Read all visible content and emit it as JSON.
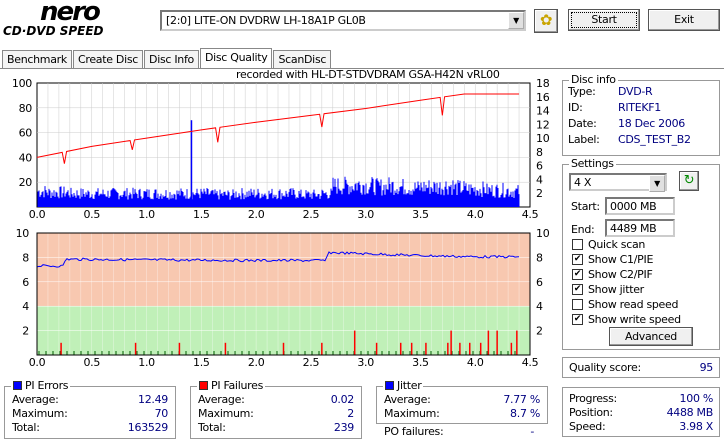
{
  "header": {
    "logo_top": "nero",
    "logo_bottom": "CD·DVD SPEED",
    "drive": "[2:0]  LITE-ON DVDRW LH-18A1P GL0B",
    "start": "Start",
    "exit": "Exit"
  },
  "tabs": [
    "Benchmark",
    "Create Disc",
    "Disc Info",
    "Disc Quality",
    "ScanDisc"
  ],
  "active_tab": "Disc Quality",
  "recorded_with": "recorded with HL-DT-STDVDRAM GSA-H42N  vRL00",
  "disc_info": {
    "title": "Disc info",
    "rows": [
      {
        "label": "Type:",
        "value": "DVD-R"
      },
      {
        "label": "ID:",
        "value": "RITEKF1"
      },
      {
        "label": "Date:",
        "value": "18 Dec 2006"
      },
      {
        "label": "Label:",
        "value": "CDS_TEST_B2"
      }
    ]
  },
  "settings": {
    "title": "Settings",
    "speed": "4 X",
    "start_label": "Start:",
    "start_value": "0000 MB",
    "end_label": "End:",
    "end_value": "4489 MB",
    "checks": [
      {
        "label": "Quick scan",
        "checked": false
      },
      {
        "label": "Show C1/PIE",
        "checked": true
      },
      {
        "label": "Show C2/PIF",
        "checked": true
      },
      {
        "label": "Show jitter",
        "checked": true
      },
      {
        "label": "Show read speed",
        "checked": false
      },
      {
        "label": "Show write speed",
        "checked": true
      }
    ],
    "advanced": "Advanced"
  },
  "quality": {
    "label": "Quality score:",
    "value": "95"
  },
  "progress": {
    "rows": [
      {
        "label": "Progress:",
        "value": "100 %"
      },
      {
        "label": "Position:",
        "value": "4488 MB"
      },
      {
        "label": "Speed:",
        "value": "3.98 X"
      }
    ]
  },
  "pi_errors": {
    "title": "PI Errors",
    "color": "#0000ff",
    "rows": [
      {
        "label": "Average:",
        "value": "12.49"
      },
      {
        "label": "Maximum:",
        "value": "70"
      },
      {
        "label": "Total:",
        "value": "163529"
      }
    ]
  },
  "pi_failures": {
    "title": "PI Failures",
    "color": "#ff0000",
    "rows": [
      {
        "label": "Average:",
        "value": "0.02"
      },
      {
        "label": "Maximum:",
        "value": "2"
      },
      {
        "label": "Total:",
        "value": "239"
      }
    ]
  },
  "jitter": {
    "title": "Jitter",
    "color": "#0000ff",
    "rows": [
      {
        "label": "Average:",
        "value": "7.77 %"
      },
      {
        "label": "Maximum:",
        "value": "8.7 %"
      }
    ],
    "po_label": "PO failures:",
    "po_value": "-"
  },
  "chart_data": [
    {
      "type": "bar+line",
      "name": "PI errors / write speed",
      "xlim": [
        0,
        4.5
      ],
      "ylim_left": [
        0,
        100
      ],
      "ylim_right": [
        0,
        18
      ],
      "x_ticks": [
        "0.0",
        "0.5",
        "1.0",
        "1.5",
        "2.0",
        "2.5",
        "3.0",
        "3.5",
        "4.0",
        "4.5"
      ],
      "y_ticks_left": [
        "100",
        "80",
        "60",
        "40",
        "20"
      ],
      "y_ticks_right": [
        "18",
        "16",
        "14",
        "12",
        "10",
        "8",
        "6",
        "4",
        "2"
      ],
      "pi_errors_profile_step": 0.1,
      "pi_errors_profile": [
        14,
        13,
        13,
        12,
        12,
        12,
        12,
        12,
        12,
        12,
        12,
        12,
        12,
        12,
        12,
        12,
        11,
        11,
        12,
        12,
        12,
        12,
        12,
        12,
        11,
        11,
        12,
        19,
        19,
        20,
        19,
        18,
        19,
        18,
        17,
        18,
        18,
        19,
        17,
        16,
        16,
        15,
        15,
        14
      ],
      "pi_errors_spikes": [
        {
          "x": 1.41,
          "y": 70
        }
      ],
      "write_speed": [
        [
          0,
          7.2
        ],
        [
          0.5,
          8.8
        ],
        [
          1,
          10
        ],
        [
          1.5,
          11.2
        ],
        [
          2,
          12.3
        ],
        [
          2.5,
          13.3
        ],
        [
          3,
          14.3
        ],
        [
          3.5,
          15.5
        ],
        [
          3.9,
          16.4
        ],
        [
          4.4,
          16.4
        ]
      ],
      "write_speed_dips": [
        {
          "x": 0.25,
          "y": 6.3
        },
        {
          "x": 0.87,
          "y": 8.3
        },
        {
          "x": 1.65,
          "y": 9.4
        },
        {
          "x": 2.6,
          "y": 11.6
        },
        {
          "x": 3.7,
          "y": 13.3
        }
      ]
    },
    {
      "type": "bar+line",
      "name": "PI failures / jitter",
      "xlim": [
        0,
        4.5
      ],
      "ylim": [
        0,
        10
      ],
      "x_ticks": [
        "0.0",
        "0.5",
        "1.0",
        "1.5",
        "2.0",
        "2.5",
        "3.0",
        "3.5",
        "4.0",
        "4.5"
      ],
      "y_ticks_left": [
        "10",
        "8",
        "6",
        "4",
        "2"
      ],
      "y_ticks_right": [
        "10",
        "8",
        "6",
        "4",
        "2"
      ],
      "jitter": [
        [
          0,
          7.3
        ],
        [
          0.24,
          7.3
        ],
        [
          0.26,
          7.85
        ],
        [
          1,
          7.8
        ],
        [
          2,
          7.75
        ],
        [
          2.64,
          7.75
        ],
        [
          2.66,
          8.4
        ],
        [
          3,
          8.3
        ],
        [
          3.5,
          8.15
        ],
        [
          4,
          8.05
        ],
        [
          4.4,
          8.05
        ]
      ],
      "pi_failures": [
        [
          0.22,
          1
        ],
        [
          0.9,
          1
        ],
        [
          1.3,
          1
        ],
        [
          1.72,
          1
        ],
        [
          2.25,
          1
        ],
        [
          2.6,
          1
        ],
        [
          2.9,
          2
        ],
        [
          3.1,
          1
        ],
        [
          3.32,
          1
        ],
        [
          3.42,
          1
        ],
        [
          3.55,
          1
        ],
        [
          3.75,
          1
        ],
        [
          3.78,
          2
        ],
        [
          3.86,
          1
        ],
        [
          3.95,
          1
        ],
        [
          4.05,
          1
        ],
        [
          4.12,
          2
        ],
        [
          4.2,
          2
        ],
        [
          4.33,
          1
        ],
        [
          4.38,
          2
        ]
      ]
    }
  ]
}
